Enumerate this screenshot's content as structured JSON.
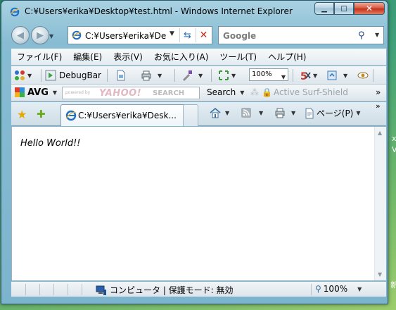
{
  "window": {
    "title": "C:¥Users¥erika¥Desktop¥test.html - Windows Internet Explorer"
  },
  "address_bar": {
    "url": "C:¥Users¥erika¥De",
    "search_placeholder": "Google"
  },
  "menu": [
    "ファイル(F)",
    "編集(E)",
    "表示(V)",
    "お気に入り(A)",
    "ツール(T)",
    "ヘルプ(H)"
  ],
  "toolbar": {
    "debugbar_label": "DebugBar",
    "zoom_value": "100%"
  },
  "avg_toolbar": {
    "avg_label": "AVG",
    "yahoo_powered": "powered by",
    "yahoo_logo": "YAHOO!",
    "yahoo_search": "SEARCH",
    "search_label": "Search",
    "surf_shield_label": "Active  Surf-Shield",
    "more": "»"
  },
  "tabs": {
    "active_title": "C:¥Users¥erika¥Desk...",
    "page_menu_label": "ページ(P)",
    "chevron": "»"
  },
  "content": {
    "text": "Hello World!!"
  },
  "status_bar": {
    "zone_text": "コンピュータ | 保護モード: 無効",
    "zoom_text": "100%"
  },
  "desktop": {
    "glyph1": "x",
    "glyph2": "V",
    "glyph3": "新"
  }
}
